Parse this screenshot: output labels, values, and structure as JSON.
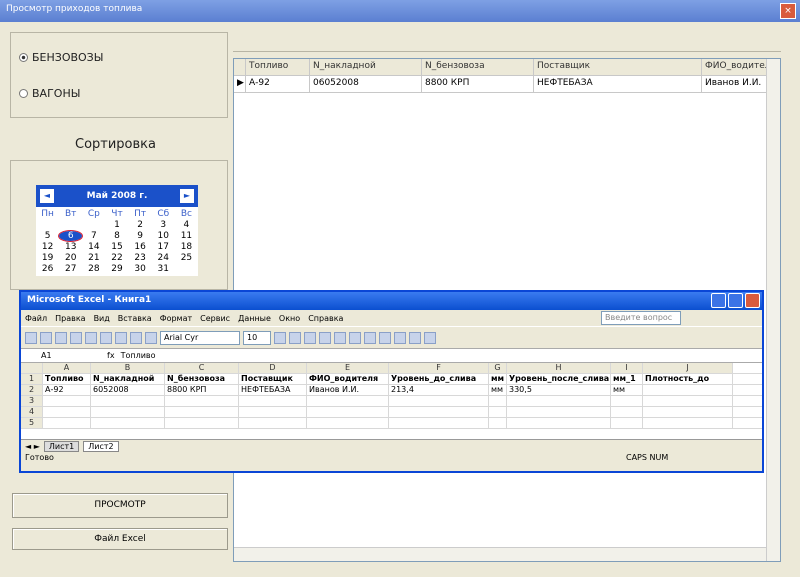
{
  "window": {
    "title": "Просмотр приходов топлива",
    "close": "×"
  },
  "radios": [
    {
      "label": "БЕНЗОВОЗЫ",
      "checked": true
    },
    {
      "label": "ВАГОНЫ",
      "checked": false
    }
  ],
  "sort_label": "Сортировка",
  "calendar": {
    "title": "Май 2008 г.",
    "prev": "◄",
    "next": "►",
    "days": [
      "Пн",
      "Вт",
      "Ср",
      "Чт",
      "Пт",
      "Сб",
      "Вс"
    ],
    "dates": [
      "",
      "",
      "",
      "1",
      "2",
      "3",
      "4",
      "5",
      "6",
      "7",
      "8",
      "9",
      "10",
      "11",
      "12",
      "13",
      "14",
      "15",
      "16",
      "17",
      "18",
      "19",
      "20",
      "21",
      "22",
      "23",
      "24",
      "25",
      "26",
      "27",
      "28",
      "29",
      "30",
      "31",
      ""
    ],
    "selected": "6"
  },
  "buttons": {
    "view": "ПРОСМОТР",
    "excel": "Файл Excel"
  },
  "grid": {
    "columns": [
      "Топливо",
      "N_накладной",
      "N_бензовоза",
      "Поставщик",
      "ФИО_водител"
    ],
    "rows": [
      [
        "А-92",
        "06052008",
        "8800 КРП",
        "НЕФТЕБАЗА",
        "Иванов И.И."
      ]
    ]
  },
  "excel": {
    "title": "Microsoft Excel - Книга1",
    "menu": [
      "Файл",
      "Правка",
      "Вид",
      "Вставка",
      "Формат",
      "Сервис",
      "Данные",
      "Окно",
      "Справка"
    ],
    "help_placeholder": "Введите вопрос",
    "font": "Arial Cyr",
    "size": "10",
    "cell_ref": "A1",
    "formula": "Топливо",
    "col_letters": [
      "A",
      "B",
      "C",
      "D",
      "E",
      "F",
      "G",
      "H",
      "I",
      "J"
    ],
    "row_numbers": [
      "1",
      "2",
      "3",
      "4",
      "5"
    ],
    "header_row": [
      "Топливо",
      "N_накладной",
      "N_бензовоза",
      "Поставщик",
      "ФИО_водителя",
      "Уровень_до_слива",
      "мм",
      "Уровень_после_слива",
      "мм_1",
      "Плотность_до"
    ],
    "data_row": [
      "А-92",
      "6052008",
      "8800 КРП",
      "НЕФТЕБАЗА",
      "Иванов И.И.",
      "213,4",
      "мм",
      "330,5",
      "мм",
      ""
    ],
    "tabs": [
      "Лист1",
      "Лист2"
    ],
    "status": "Готово",
    "indicators": "CAPS NUM"
  }
}
